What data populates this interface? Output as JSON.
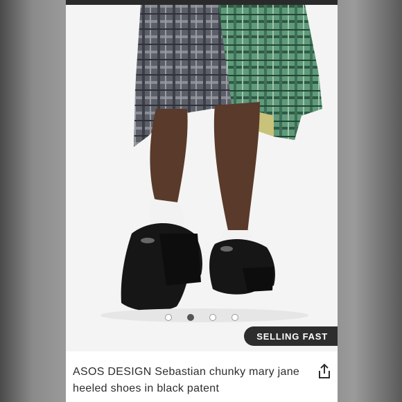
{
  "carousel": {
    "photo_icon": "product-photo",
    "dots": [
      "inactive",
      "active",
      "inactive",
      "inactive"
    ],
    "active_index": 1
  },
  "badge": {
    "label": "SELLING FAST"
  },
  "product": {
    "title": "ASOS DESIGN Sebastian chunky mary jane heeled shoes in black patent"
  },
  "icons": {
    "share": "share-icon"
  },
  "colors": {
    "badge_bg": "#2d2d2d",
    "text": "#2d2d2d",
    "dot_active": "#555555"
  }
}
